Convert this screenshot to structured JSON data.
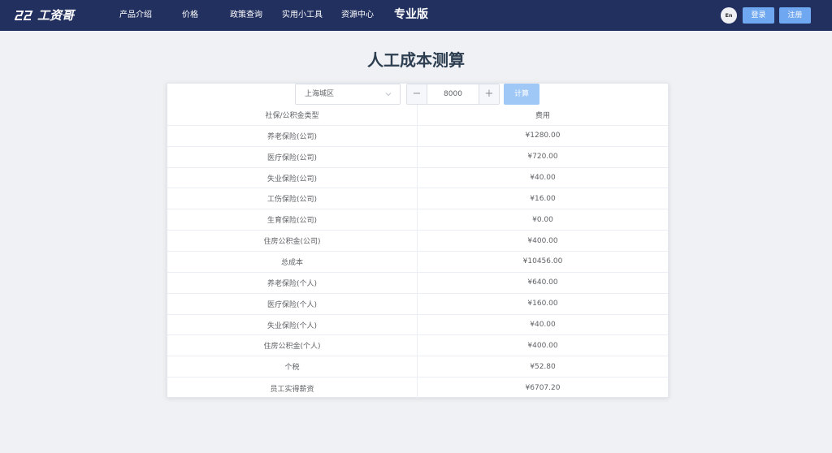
{
  "app": {
    "logo_text": "工资哥"
  },
  "nav": {
    "items": [
      "产品介绍",
      "价格",
      "政策查询",
      "实用小工具",
      "资源中心"
    ],
    "pro": "专业版",
    "lang": "En",
    "login": "登录",
    "register": "注册"
  },
  "page": {
    "title": "人工成本测算"
  },
  "form": {
    "city": "上海城区",
    "salary": "8000",
    "minus_icon": "−",
    "plus_icon": "+",
    "calc_label": "计算"
  },
  "table": {
    "headers": [
      "社保/公积金类型",
      "费用"
    ],
    "rows": [
      [
        "养老保险(公司)",
        "¥1280.00"
      ],
      [
        "医疗保险(公司)",
        "¥720.00"
      ],
      [
        "失业保险(公司)",
        "¥40.00"
      ],
      [
        "工伤保险(公司)",
        "¥16.00"
      ],
      [
        "生育保险(公司)",
        "¥0.00"
      ],
      [
        "住房公积金(公司)",
        "¥400.00"
      ],
      [
        "总成本",
        "¥10456.00"
      ],
      [
        "养老保险(个人)",
        "¥640.00"
      ],
      [
        "医疗保险(个人)",
        "¥160.00"
      ],
      [
        "失业保险(个人)",
        "¥40.00"
      ],
      [
        "住房公积金(个人)",
        "¥400.00"
      ],
      [
        "个税",
        "¥52.80"
      ],
      [
        "员工实得薪资",
        "¥6707.20"
      ]
    ]
  },
  "colors": {
    "topbar": "#22305f",
    "primary_button": "#6fa7f0",
    "calc_button": "#a0c8f7",
    "page_bg": "#f0f1f4"
  }
}
